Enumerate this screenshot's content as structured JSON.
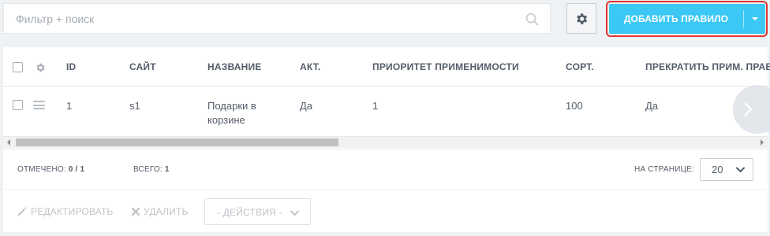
{
  "toolbar": {
    "search_placeholder": "Фильтр + поиск",
    "search_value": "",
    "add_button_label": "Добавить правило",
    "accent_color": "#3bc8f5",
    "highlight_color": "#e0332f"
  },
  "grid": {
    "columns": [
      "ID",
      "Сайт",
      "Название",
      "Акт.",
      "Приоритет применимости",
      "Сорт.",
      "Прекратить прим. прави"
    ],
    "rows": [
      {
        "checked": false,
        "id": "1",
        "site": "s1",
        "name": "Подарки в корзине",
        "active": "Да",
        "priority": "1",
        "sort": "100",
        "stop": "Да"
      }
    ],
    "footer": {
      "selected_label": "Отмечено:",
      "selected_value": "0 / 1",
      "total_label": "Всего:",
      "total_value": "1",
      "per_page_label": "На странице:",
      "per_page_value": "20"
    },
    "actions": {
      "edit_label": "Редактировать",
      "delete_label": "Удалить",
      "actions_select_value": "- Действия -"
    }
  },
  "icons": {
    "search": "search-icon",
    "settings": "gear-icon",
    "dropdown": "caret-down-icon",
    "row_menu": "hamburger-icon",
    "scroll_right": "chevron-right-icon",
    "edit": "pencil-icon",
    "delete": "cross-icon"
  }
}
